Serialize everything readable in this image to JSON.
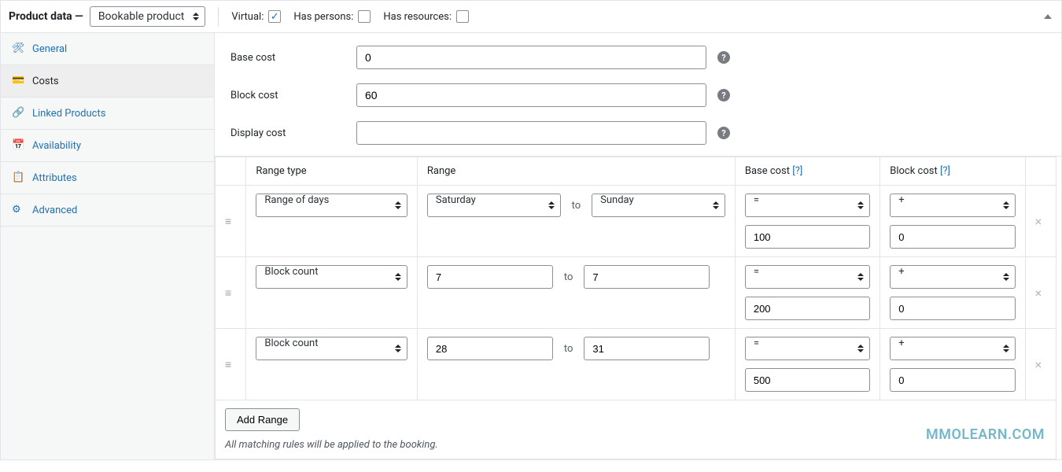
{
  "header": {
    "title": "Product data —",
    "product_type": "Bookable product",
    "checkboxes": {
      "virtual_label": "Virtual:",
      "virtual_checked": true,
      "has_persons_label": "Has persons:",
      "has_persons_checked": false,
      "has_resources_label": "Has resources:",
      "has_resources_checked": false
    }
  },
  "sidebar": {
    "items": [
      {
        "label": "General",
        "icon": "wrench-icon"
      },
      {
        "label": "Costs",
        "icon": "card-icon"
      },
      {
        "label": "Linked Products",
        "icon": "link-icon"
      },
      {
        "label": "Availability",
        "icon": "calendar-icon"
      },
      {
        "label": "Attributes",
        "icon": "list-icon"
      },
      {
        "label": "Advanced",
        "icon": "gear-icon"
      }
    ],
    "active_index": 1
  },
  "form": {
    "base_cost_label": "Base cost",
    "base_cost_value": "0",
    "block_cost_label": "Block cost",
    "block_cost_value": "60",
    "display_cost_label": "Display cost",
    "display_cost_value": ""
  },
  "rules": {
    "headers": {
      "range_type": "Range type",
      "range": "Range",
      "base_cost": "Base cost",
      "block_cost": "Block cost",
      "help": "[?]"
    },
    "to_label": "to",
    "rows": [
      {
        "type": "Range of days",
        "mode": "select",
        "from": "Saturday",
        "to": "Sunday",
        "base_op": "=",
        "base_val": "100",
        "block_op": "+",
        "block_val": "0"
      },
      {
        "type": "Block count",
        "mode": "input",
        "from": "7",
        "to": "7",
        "base_op": "=",
        "base_val": "200",
        "block_op": "+",
        "block_val": "0"
      },
      {
        "type": "Block count",
        "mode": "input",
        "from": "28",
        "to": "31",
        "base_op": "=",
        "base_val": "500",
        "block_op": "+",
        "block_val": "0"
      }
    ],
    "add_button": "Add Range",
    "footer_note": "All matching rules will be applied to the booking."
  },
  "watermark": "MMOLEARN.COM"
}
